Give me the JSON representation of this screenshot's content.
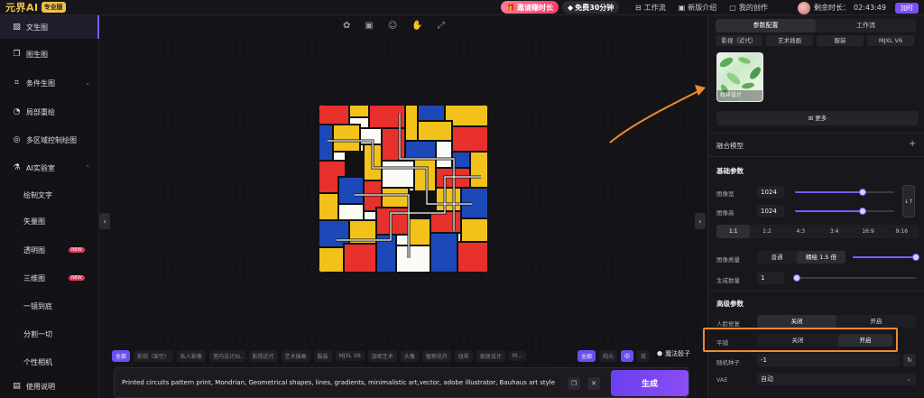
{
  "header": {
    "logo": "元界AI",
    "pro_badge": "专业版",
    "invite": "邀请赚时长",
    "free": "免费30分钟",
    "nav": [
      "工作流",
      "新版介绍",
      "我的创作"
    ],
    "remaining_label": "剩余时长：",
    "remaining_time": "02:43:49",
    "renew": "加时"
  },
  "sidebar": {
    "items": [
      {
        "label": "文生图",
        "icon": "image-icon"
      },
      {
        "label": "图生图",
        "icon": "images-icon"
      },
      {
        "label": "条件生图",
        "icon": "nodes-icon"
      },
      {
        "label": "局部重绘",
        "icon": "brush-icon"
      },
      {
        "label": "多区域控制绘图",
        "icon": "region-icon"
      },
      {
        "label": "AI实验室",
        "icon": "flask-icon"
      },
      {
        "label": "绘制文字"
      },
      {
        "label": "矢量图"
      },
      {
        "label": "透明图",
        "badge": "NEW"
      },
      {
        "label": "三维图",
        "badge": "NEW"
      },
      {
        "label": "一镜到底"
      },
      {
        "label": "分割一切"
      },
      {
        "label": "个性相机"
      },
      {
        "label": "使用说明",
        "icon": "book-icon"
      }
    ]
  },
  "canvas": {
    "tags": [
      "全部",
      "影视（架空）",
      "私人影像",
      "室内设计XL",
      "影视近代",
      "艺术插画",
      "服装",
      "MJXL V6",
      "加密艺术",
      "头像",
      "植物花卉",
      "纹样",
      "家居设计",
      "M..."
    ],
    "lang_tags": [
      "全部",
      "纯元",
      "中",
      "英"
    ],
    "magic": "魔法骰子",
    "prompt": "Printed circuits pattern print, Mondrian, Geometrical shapes, lines, gradients, minimalistic art,vector, adobe illustrator, Bauhaus art style",
    "generate": "生成"
  },
  "panel": {
    "tabs": [
      "参数配置",
      "工作流"
    ],
    "styles": [
      "影视（近代）",
      "艺术插画",
      "服装",
      "MJXL V6"
    ],
    "selected_style": "纹样设计",
    "more": "更多",
    "fusion": "融合模型",
    "basic": "基础参数",
    "width_label": "图像宽",
    "width": "1024",
    "height_label": "图像高",
    "height": "1024",
    "ratios": [
      "1:1",
      "1:2",
      "4:3",
      "3:4",
      "16:9",
      "9:16"
    ],
    "quality_label": "图像质量",
    "quality_opts": [
      "普通",
      "精绘 1.5 倍"
    ],
    "count_label": "生成数量",
    "count": "1",
    "advanced": "高级参数",
    "face_label": "人脸修复",
    "face_opts": [
      "关闭",
      "开启"
    ],
    "tile_label": "平铺",
    "tile_opts": [
      "关闭",
      "开启"
    ],
    "seed_label": "随机种子",
    "seed": "-1",
    "vae_label": "VAE",
    "vae": "自动"
  }
}
